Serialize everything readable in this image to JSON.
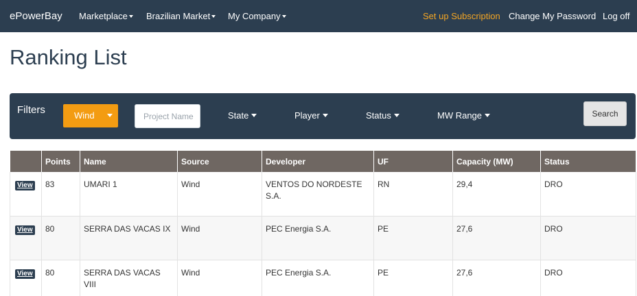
{
  "navbar": {
    "brand": "ePowerBay",
    "menus": [
      "Marketplace",
      "Brazilian Market",
      "My Company"
    ],
    "subscription": "Set up Subscription",
    "change_password": "Change My Password",
    "logoff": "Log off",
    "accent_color": "#f5a623",
    "background_color": "#2c3e50"
  },
  "page_title": "Ranking List",
  "filters": {
    "label": "Filters",
    "source_selected": "Wind",
    "project_placeholder": "Project Name",
    "state_label": "State",
    "player_label": "Player",
    "status_label": "Status",
    "mw_label": "MW Range",
    "search_label": "Search",
    "source_color": "#f39c12"
  },
  "table": {
    "headers": [
      "",
      "Points",
      "Name",
      "Source",
      "Developer",
      "UF",
      "Capacity (MW)",
      "Status"
    ],
    "view_label": "View",
    "rows": [
      {
        "points": "83",
        "name": "UMARI 1",
        "source": "Wind",
        "developer": "VENTOS DO NORDESTE S.A.",
        "uf": "RN",
        "capacity": "29,4",
        "status": "DRO"
      },
      {
        "points": "80",
        "name": "SERRA DAS VACAS IX",
        "source": "Wind",
        "developer": "PEC Energia S.A.",
        "uf": "PE",
        "capacity": "27,6",
        "status": "DRO"
      },
      {
        "points": "80",
        "name": "SERRA DAS VACAS VIII",
        "source": "Wind",
        "developer": "PEC Energia S.A.",
        "uf": "PE",
        "capacity": "27,6",
        "status": "DRO"
      }
    ]
  }
}
